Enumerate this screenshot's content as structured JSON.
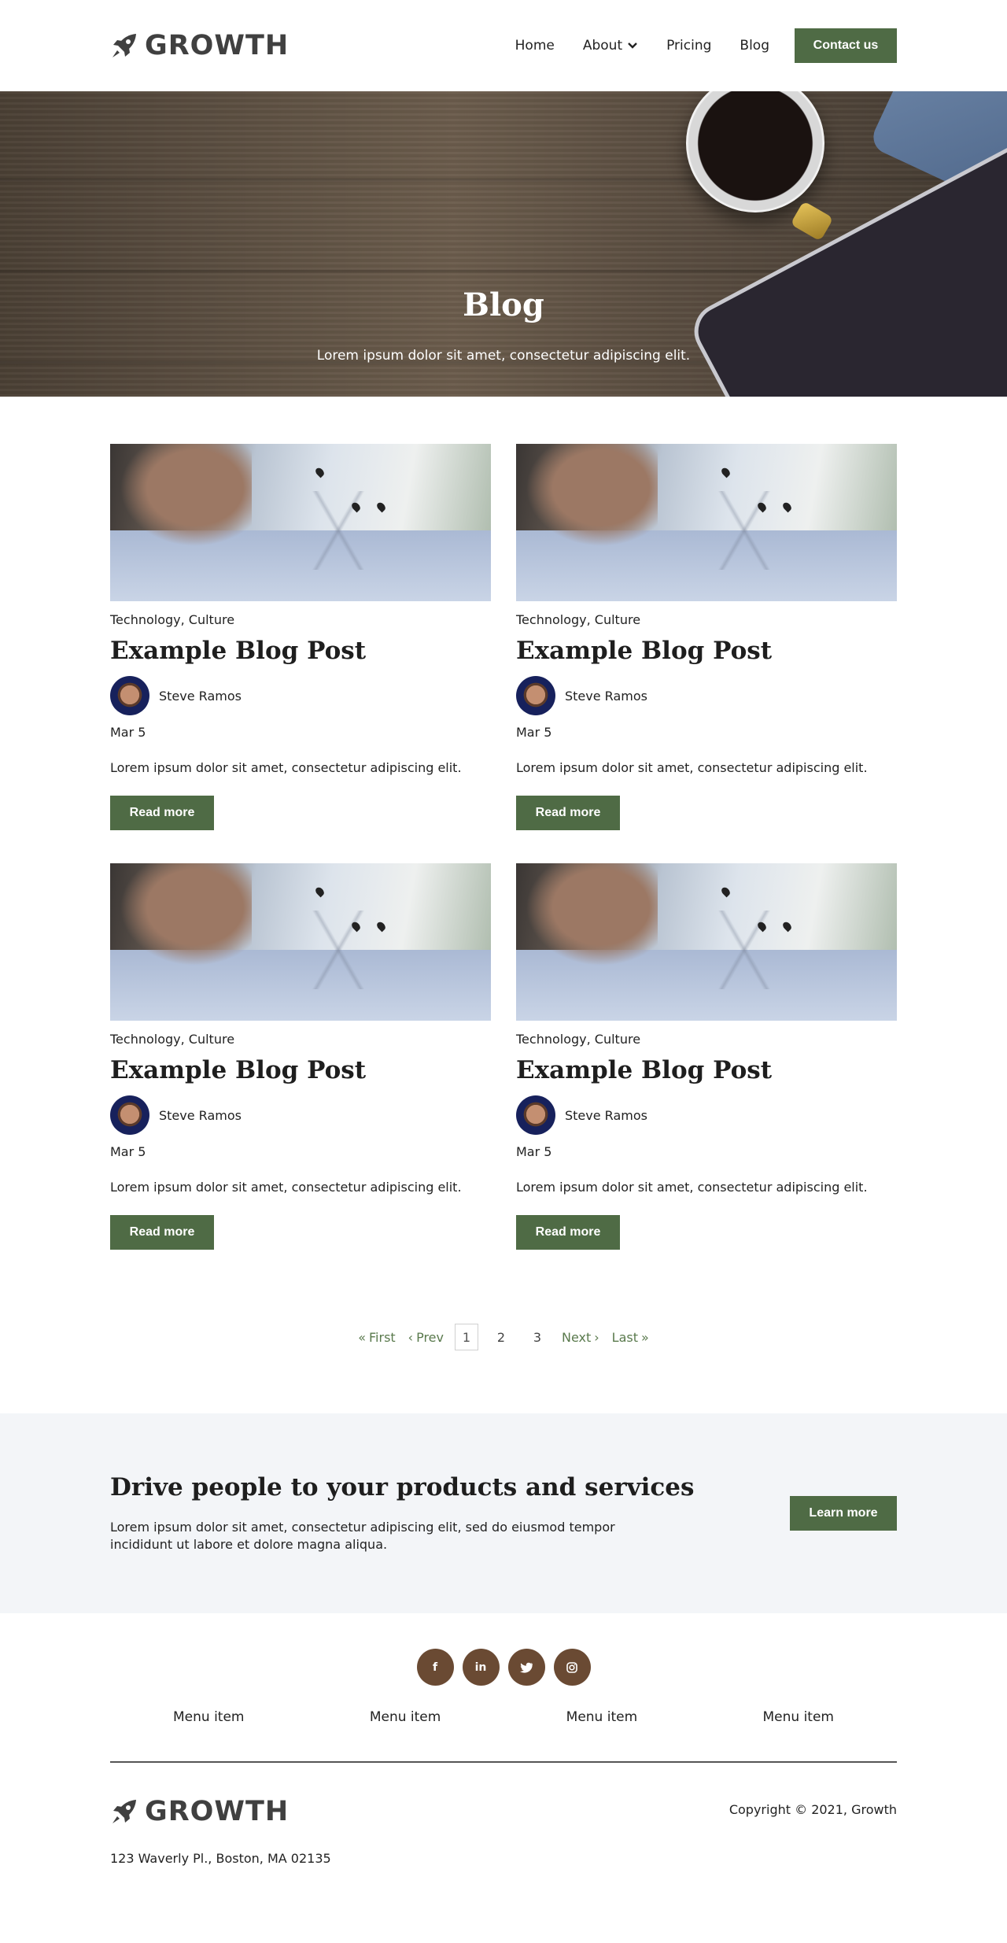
{
  "header": {
    "logo_text": "GROWTH",
    "nav": [
      {
        "label": "Home"
      },
      {
        "label": "About"
      },
      {
        "label": "Pricing"
      },
      {
        "label": "Blog"
      }
    ],
    "contact_label": "Contact us"
  },
  "hero": {
    "title": "Blog",
    "subtitle": "Lorem ipsum dolor sit amet, consectetur adipiscing elit."
  },
  "posts": [
    {
      "categories": "Technology, Culture",
      "title": "Example Blog Post",
      "author": "Steve Ramos",
      "date": "Mar 5",
      "excerpt": "Lorem ipsum dolor sit amet, consectetur adipiscing elit.",
      "button": "Read more"
    },
    {
      "categories": "Technology, Culture",
      "title": "Example Blog Post",
      "author": "Steve Ramos",
      "date": "Mar 5",
      "excerpt": "Lorem ipsum dolor sit amet, consectetur adipiscing elit.",
      "button": "Read more"
    },
    {
      "categories": "Technology, Culture",
      "title": "Example Blog Post",
      "author": "Steve Ramos",
      "date": "Mar 5",
      "excerpt": "Lorem ipsum dolor sit amet, consectetur adipiscing elit.",
      "button": "Read more"
    },
    {
      "categories": "Technology, Culture",
      "title": "Example Blog Post",
      "author": "Steve Ramos",
      "date": "Mar 5",
      "excerpt": "Lorem ipsum dolor sit amet, consectetur adipiscing elit.",
      "button": "Read more"
    }
  ],
  "pagination": {
    "first": "First",
    "prev": "Prev",
    "current": "1",
    "pages": [
      "2",
      "3"
    ],
    "next": "Next",
    "last": "Last"
  },
  "cta": {
    "title": "Drive people to your products and services",
    "text": "Lorem ipsum dolor sit amet, consectetur adipiscing elit, sed do eiusmod tempor incididunt ut labore et dolore magna aliqua.",
    "button": "Learn more"
  },
  "footer": {
    "social": [
      {
        "icon": "facebook-icon",
        "glyph": "f"
      },
      {
        "icon": "linkedin-icon",
        "glyph": "in"
      },
      {
        "icon": "twitter-icon",
        "glyph": "🐦"
      },
      {
        "icon": "instagram-icon",
        "glyph": "◎"
      }
    ],
    "menu": [
      "Menu item",
      "Menu item",
      "Menu item",
      "Menu item"
    ],
    "logo_text": "GROWTH",
    "copyright": "Copyright © 2021, Growth",
    "address": "123 Waverly Pl., Boston, MA 02135"
  },
  "colors": {
    "accent_green": "#4f6b45",
    "social_brown": "#6a4a33",
    "link_green": "#5a7a4d",
    "cta_bg": "#f3f5f8"
  }
}
